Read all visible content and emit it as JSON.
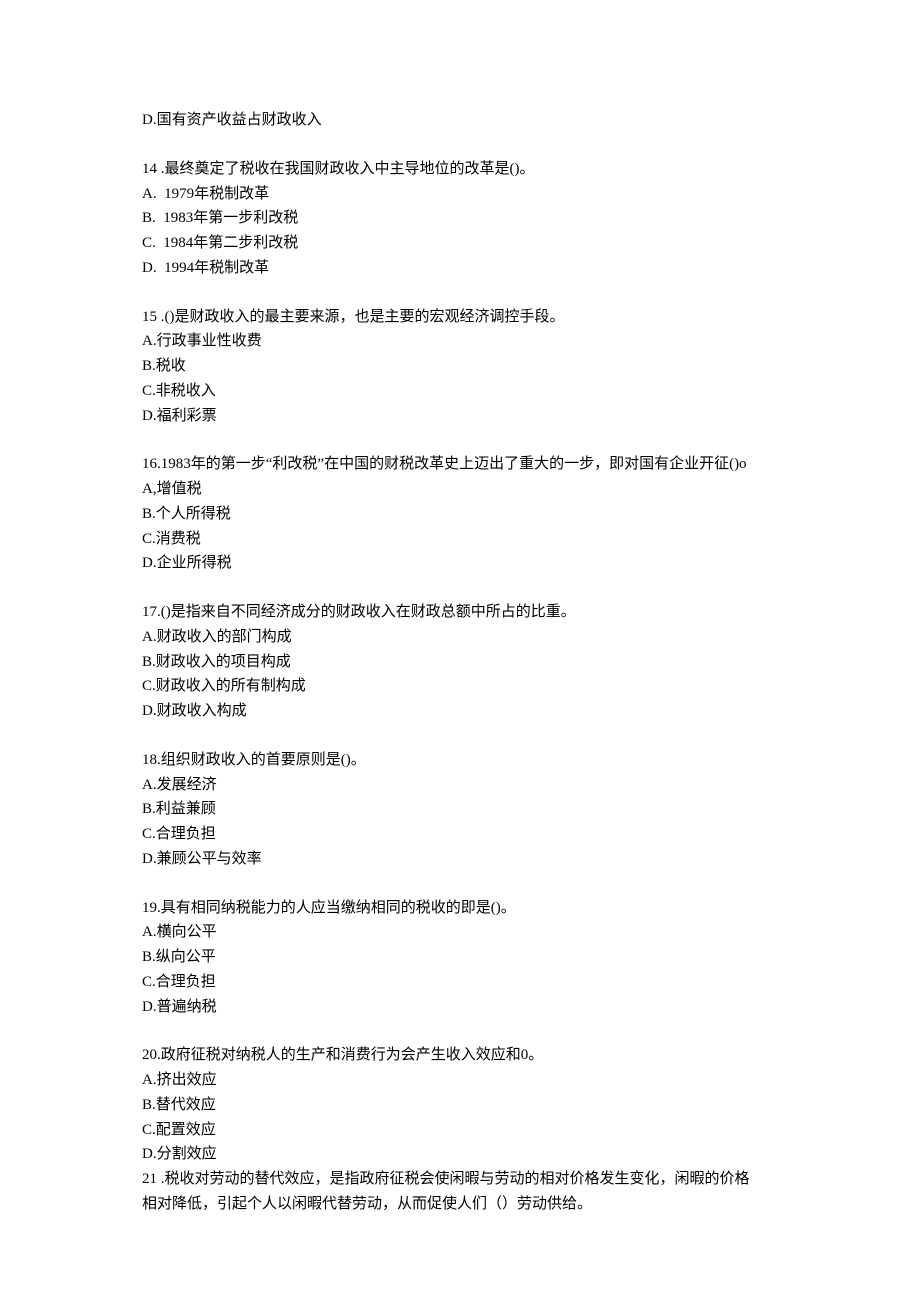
{
  "q13_optD": "D.国有资产收益占财政收入",
  "q14": {
    "stem": "14 .最终奠定了税收在我国财政收入中主导地位的改革是()。",
    "A": "A.  1979年税制改革",
    "B": "B.  1983年第一步利改税",
    "C": "C.  1984年第二步利改税",
    "D": "D.  1994年税制改革"
  },
  "q15": {
    "stem": "15 .()是财政收入的最主要来源，也是主要的宏观经济调控手段。",
    "A": "A.行政事业性收费",
    "B": "B.税收",
    "C": "C.非税收入",
    "D": "D.福利彩票"
  },
  "q16": {
    "stem": "16.1983年的第一步“利改税”在中国的财税改革史上迈出了重大的一步，即对国有企业开征()o",
    "A": "A,增值税",
    "B": "B.个人所得税",
    "C": "C.消费税",
    "D": "D.企业所得税"
  },
  "q17": {
    "stem": "17.()是指来自不同经济成分的财政收入在财政总额中所占的比重。",
    "A": "A.财政收入的部门构成",
    "B": "B.财政收入的项目构成",
    "C": "C.财政收入的所有制构成",
    "D": "D.财政收入构成"
  },
  "q18": {
    "stem": "18.组织财政收入的首要原则是()。",
    "A": "A.发展经济",
    "B": "B.利益兼顾",
    "C": "C.合理负担",
    "D": "D.兼顾公平与效率"
  },
  "q19": {
    "stem": "19.具有相同纳税能力的人应当缴纳相同的税收的即是()。",
    "A": "A.横向公平",
    "B": "B.纵向公平",
    "C": "C.合理负担",
    "D": "D.普遍纳税"
  },
  "q20": {
    "stem": "20.政府征税对纳税人的生产和消费行为会产生收入效应和0。",
    "A": "A.挤出效应",
    "B": "B.替代效应",
    "C": "C.配置效应",
    "D": "D.分割效应"
  },
  "q21": {
    "stem1": "21 .税收对劳动的替代效应，是指政府征税会使闲暇与劳动的相对价格发生变化，闲暇的价格",
    "stem2": "相对降低，引起个人以闲暇代替劳动，从而促使人们（）劳动供给。"
  }
}
